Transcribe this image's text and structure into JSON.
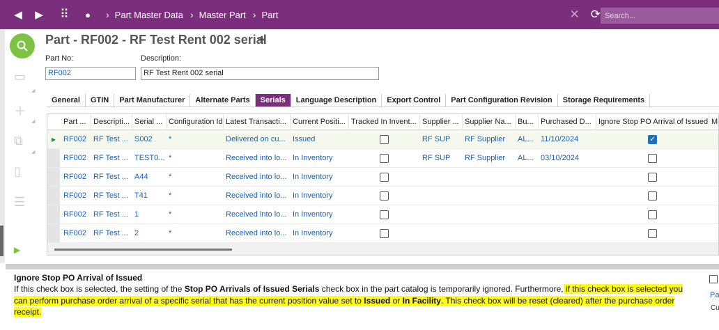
{
  "topbar": {
    "back_icon": "◀",
    "forward_icon": "▶",
    "apps_icon": "⠿",
    "dot_icon": "●",
    "breadcrumbs": [
      "Part Master Data",
      "Master Part",
      "Part"
    ],
    "close_icon": "✕",
    "refresh_icon": "⟳",
    "search_placeholder": "Search..."
  },
  "header": {
    "title": "Part - RF002 - RF Test Rent 002 serial",
    "pin_icon": "📌",
    "part_no_label": "Part No:",
    "part_no_value": "RF002",
    "description_label": "Description:",
    "description_value": "RF Test Rent 002 serial"
  },
  "tabs": [
    {
      "label": "General"
    },
    {
      "label": "GTIN"
    },
    {
      "label": "Part Manufacturer"
    },
    {
      "label": "Alternate Parts"
    },
    {
      "label": "Serials",
      "active": true
    },
    {
      "label": "Language Description"
    },
    {
      "label": "Export Control"
    },
    {
      "label": "Part Configuration Revision"
    },
    {
      "label": "Storage Requirements"
    }
  ],
  "grid": {
    "columns": [
      "Part ...",
      "Descripti...",
      "Serial ...",
      "Configuration Id",
      "Latest Transacti...",
      "Current Positi...",
      "Tracked In Invent...",
      "Supplier ...",
      "Supplier Na...",
      "Bu...",
      "Purchased D...",
      "Ignore Stop PO Arrival of Issued",
      "Ma"
    ],
    "rows": [
      {
        "part": "RF002",
        "desc": "RF Test ...",
        "serial": "S002",
        "config": "*",
        "latest": "Delivered on cu...",
        "position": "Issued",
        "tracked": false,
        "supplier": "RF SUP",
        "supplier_name": "RF Supplier",
        "bu": "AL...",
        "purchased": "11/10/2024",
        "ignore_stop": true
      },
      {
        "part": "RF002",
        "desc": "RF Test ...",
        "serial": "TEST0...",
        "config": "*",
        "latest": "Received into lo...",
        "position": "In Inventory",
        "tracked": false,
        "supplier": "RF SUP",
        "supplier_name": "RF Supplier",
        "bu": "AL...",
        "purchased": "03/10/2024",
        "ignore_stop": false
      },
      {
        "part": "RF002",
        "desc": "RF Test ...",
        "serial": "A44",
        "config": "*",
        "latest": "Received into lo...",
        "position": "In Inventory",
        "tracked": false,
        "supplier": "",
        "supplier_name": "",
        "bu": "",
        "purchased": "",
        "ignore_stop": false
      },
      {
        "part": "RF002",
        "desc": "RF Test ...",
        "serial": "T41",
        "config": "*",
        "latest": "Received into lo...",
        "position": "In Inventory",
        "tracked": false,
        "supplier": "",
        "supplier_name": "",
        "bu": "",
        "purchased": "",
        "ignore_stop": false
      },
      {
        "part": "RF002",
        "desc": "RF Test ...",
        "serial": "1",
        "config": "*",
        "latest": "Received into lo...",
        "position": "In Inventory",
        "tracked": false,
        "supplier": "",
        "supplier_name": "",
        "bu": "",
        "purchased": "",
        "ignore_stop": false
      },
      {
        "part": "RF002",
        "desc": "RF Test ...",
        "serial": "2",
        "config": "*",
        "latest": "Received into lo...",
        "position": "In Inventory",
        "tracked": false,
        "supplier": "",
        "supplier_name": "",
        "bu": "",
        "purchased": "",
        "ignore_stop": false
      }
    ]
  },
  "help": {
    "title": "Ignore Stop PO Arrival of Issued",
    "p1": "If this check box is selected, the setting of the ",
    "b1": "Stop PO Arrivals of Issued Serials",
    "p2": " check box in the part catalog is temporarily ignored. Furthermore,",
    "h1": " if this check box is selected you can perform purchase order arrival of a specific serial that has the current position value set to ",
    "hb1": "Issued",
    "h2": " or ",
    "hb2": "In Facility",
    "h3": ". This check box will be reset (cleared) after the purchase order receipt.",
    "side_link": "Pa",
    "side_cu": "Cu"
  },
  "colors": {
    "brand": "#7a2e7c",
    "accent_green": "#7cc243",
    "link": "#1a5fb4",
    "highlight": "#fffb1f"
  }
}
